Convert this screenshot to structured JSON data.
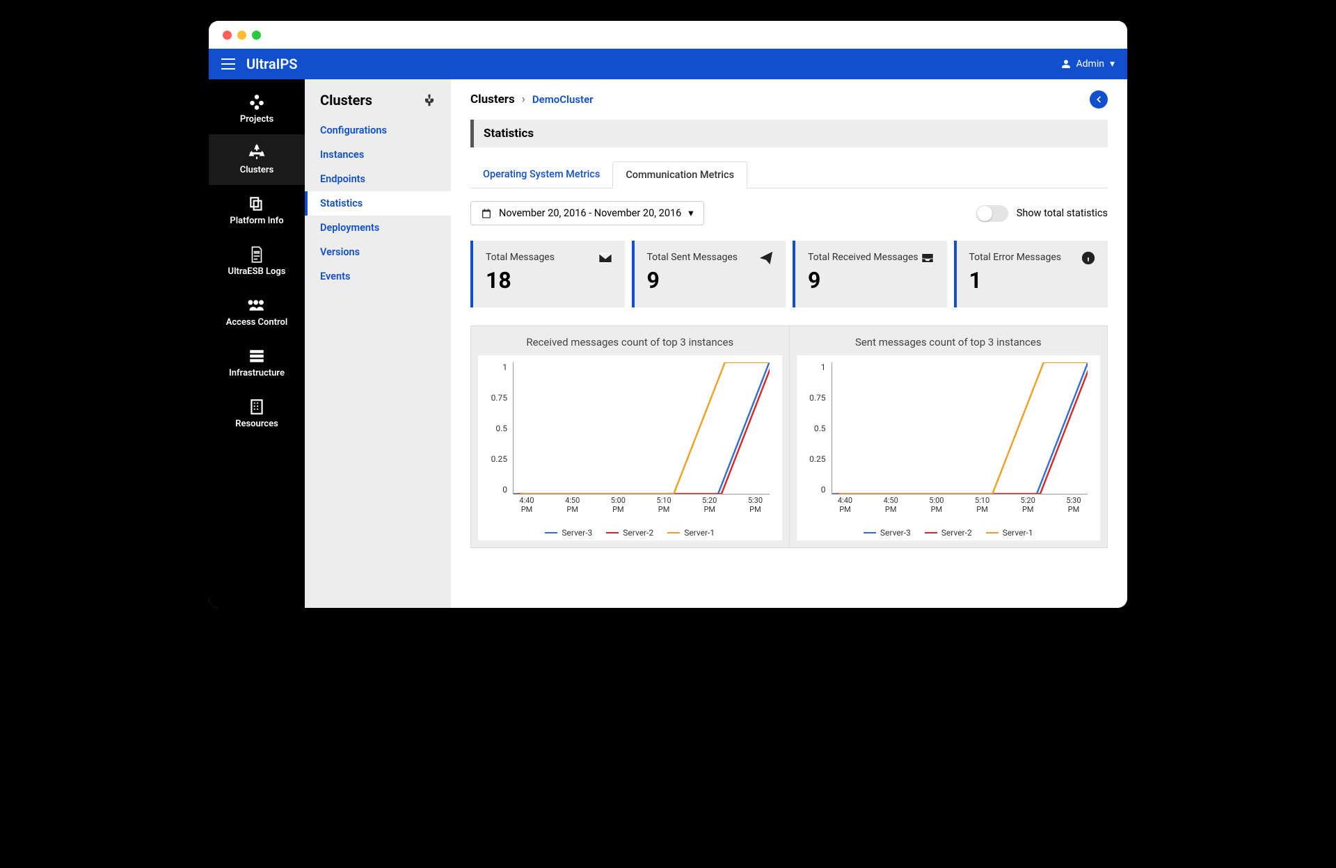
{
  "brand": "UltraIPS",
  "user": {
    "name": "Admin"
  },
  "leftnav": [
    {
      "id": "projects",
      "label": "Projects"
    },
    {
      "id": "clusters",
      "label": "Clusters"
    },
    {
      "id": "platform-info",
      "label": "Platform Info"
    },
    {
      "id": "ultraesb-logs",
      "label": "UltraESB Logs"
    },
    {
      "id": "access-control",
      "label": "Access Control"
    },
    {
      "id": "infrastructure",
      "label": "Infrastructure"
    },
    {
      "id": "resources",
      "label": "Resources"
    }
  ],
  "leftnav_active": "clusters",
  "subnav": {
    "title": "Clusters",
    "items": [
      "Configurations",
      "Instances",
      "Endpoints",
      "Statistics",
      "Deployments",
      "Versions",
      "Events"
    ],
    "active": "Statistics"
  },
  "breadcrumb": {
    "root": "Clusters",
    "leaf": "DemoCluster"
  },
  "section_title": "Statistics",
  "tabs": [
    "Operating System Metrics",
    "Communication Metrics"
  ],
  "active_tab": "Communication Metrics",
  "date_range": "November 20, 2016 - November 20, 2016",
  "toggle_label": "Show total statistics",
  "toggle_on": false,
  "stats": [
    {
      "label": "Total Messages",
      "value": "18",
      "icon": "envelope"
    },
    {
      "label": "Total Sent Messages",
      "value": "9",
      "icon": "paper-plane"
    },
    {
      "label": "Total Received Messages",
      "value": "9",
      "icon": "inbox"
    },
    {
      "label": "Total Error Messages",
      "value": "1",
      "icon": "info"
    }
  ],
  "chart_data": [
    {
      "type": "line",
      "title": "Received messages count of top 3 instances",
      "ylim": [
        0,
        1
      ],
      "y_ticks": [
        "1",
        "0.75",
        "0.5",
        "0.25",
        "0"
      ],
      "categories": [
        "4:40 PM",
        "4:50 PM",
        "5:00 PM",
        "5:10 PM",
        "5:20 PM",
        "5:30 PM"
      ],
      "series": [
        {
          "name": "Server-3",
          "color": "#2f6fd0",
          "values": [
            0,
            0,
            0,
            0,
            0,
            1
          ]
        },
        {
          "name": "Server-2",
          "color": "#d62728",
          "values": [
            0,
            0,
            0,
            0,
            0,
            1
          ]
        },
        {
          "name": "Server-1",
          "color": "#f0a020",
          "values": [
            0,
            0,
            0,
            0,
            1,
            1
          ]
        }
      ]
    },
    {
      "type": "line",
      "title": "Sent messages count of top 3 instances",
      "ylim": [
        0,
        1
      ],
      "y_ticks": [
        "1",
        "0.75",
        "0.5",
        "0.25",
        "0"
      ],
      "categories": [
        "4:40 PM",
        "4:50 PM",
        "5:00 PM",
        "5:10 PM",
        "5:20 PM",
        "5:30 PM"
      ],
      "series": [
        {
          "name": "Server-3",
          "color": "#2f6fd0",
          "values": [
            0,
            0,
            0,
            0,
            0,
            1
          ]
        },
        {
          "name": "Server-2",
          "color": "#d62728",
          "values": [
            0,
            0,
            0,
            0,
            0,
            1
          ]
        },
        {
          "name": "Server-1",
          "color": "#f0a020",
          "values": [
            0,
            0,
            0,
            0,
            1,
            1
          ]
        }
      ]
    }
  ]
}
